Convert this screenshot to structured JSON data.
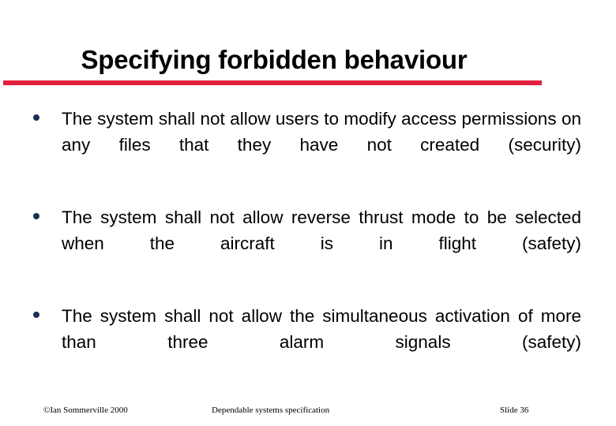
{
  "slide": {
    "title": "Specifying forbidden behaviour",
    "accent_color": "#E3203C",
    "bullet_color": "#1B2F55",
    "background_color": "#FFFFFF",
    "text_color": "#000000",
    "bullets": [
      {
        "text": "The system shall not allow users to modify access permissions on any files that they have not created (security)"
      },
      {
        "text": "The system shall not allow reverse thrust mode to be selected when the aircraft is in flight  (safety)"
      },
      {
        "text": "The system shall not allow the simultaneous activation of more than three alarm signals (safety)"
      }
    ]
  },
  "footer": {
    "copyright": "©Ian Sommerville 2000",
    "subject": "Dependable systems specification",
    "slide_number": "Slide 36"
  }
}
